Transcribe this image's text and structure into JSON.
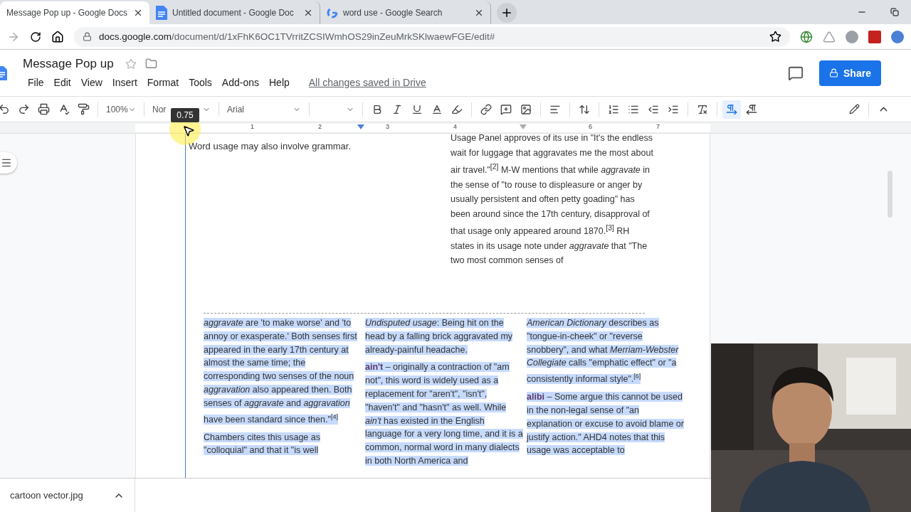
{
  "browser": {
    "tabs": [
      {
        "title": "Message Pop up - Google Docs",
        "selected": true,
        "kind": "plain"
      },
      {
        "title": "Untitled document - Google Doc",
        "selected": false,
        "kind": "docs"
      },
      {
        "title": "word use - Google Search",
        "selected": false,
        "kind": "google"
      }
    ],
    "url_host": "docs.google.com",
    "url_path": "/document/d/1xFhK6OC1TVrritZCSIWmhOS29inZeuMrkSKlwaewFGE/edit#"
  },
  "document": {
    "title": "Message Pop up",
    "menu": [
      "File",
      "Edit",
      "View",
      "Insert",
      "Format",
      "Tools",
      "Add-ons",
      "Help"
    ],
    "save_status": "All changes saved in Drive",
    "share_label": "Share"
  },
  "toolbar": {
    "zoom": "100%",
    "style": "Nor",
    "font": "Arial",
    "tooltip": "0.75",
    "text_direction": [
      {
        "selected": true
      },
      {
        "selected": false
      }
    ]
  },
  "ruler": {
    "labels": [
      "1",
      "2",
      "3",
      "4",
      "6",
      "7"
    ]
  },
  "page": {
    "top_left": "Word usage may also involve grammar.",
    "top_right": "Usage Panel approves of its use in \"It's the endless wait for luggage that aggravates me the most about air travel.\"$^{[2]}$ M-W mentions that while *aggravate* in the sense of \"to rouse to displeasure or anger by usually persistent and often petty goading\" has been around since the 17th century, disapproval of that usage only appeared around 1870.$^{[3]}$ RH states in its usage note under *aggravate* that \"The two most common senses of",
    "selected": true,
    "columns": [
      {
        "paragraphs": [
          "*aggravate* are 'to make worse' and 'to annoy or exasperate.' Both senses first appeared in the early 17th century at almost the same time; the corresponding two senses of the noun *aggravation* also appeared then. Both senses of *aggravate* and *aggravation* have been standard since then.\"$^{[4]}$",
          "Chambers cites this usage as \"colloquial\" and that it \"is well"
        ]
      },
      {
        "paragraphs": [
          "*Undisputed usage*: Being hit on the head by a falling brick aggravated my already-painful headache.",
          "**ain't** – originally a contraction of \"am not\", this word is widely used as a replacement for \"aren't\", \"isn't\", \"haven't\" and \"hasn't\" as well. While *ain't* has existed in the English language for a very long time, and it is a common, normal word in many dialects in both North America and"
        ]
      },
      {
        "paragraphs": [
          "*American Dictionary* describes as \"tongue-in-cheek\" or \"reverse snobbery\", and what *Merriam-Webster Collegiate* calls \"emphatic effect\" or \"a consistently informal style\".$^{[6]}$",
          "**alibi** – Some argue this cannot be used in the non-legal sense of \"an explanation or excuse to avoid blame or justify action.\" AHD4 notes that this usage was acceptable to"
        ]
      }
    ]
  },
  "download": {
    "file": "cartoon vector.jpg"
  }
}
